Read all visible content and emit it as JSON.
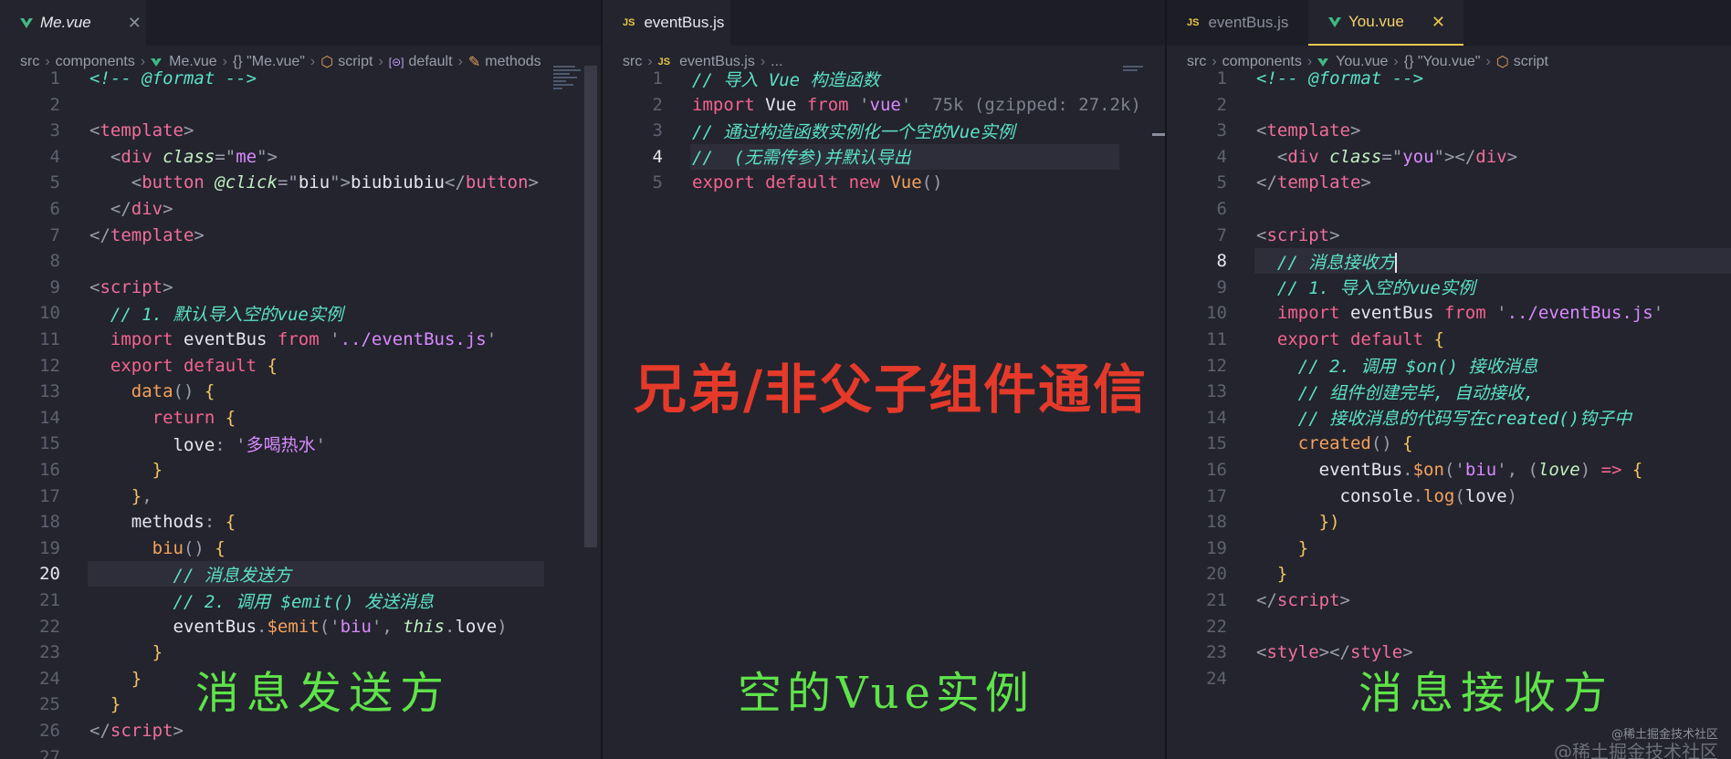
{
  "left": {
    "tab": "Me.vue",
    "crumbs": [
      "src",
      "components",
      "Me.vue",
      "{} \"Me.vue\"",
      "script",
      "default",
      "methods"
    ],
    "current_line": 20,
    "lines": [
      [
        [
          "c-com",
          "<!-- @format -->"
        ]
      ],
      [],
      [
        [
          "c-punc",
          "<"
        ],
        [
          "c-tag",
          "template"
        ],
        [
          "c-punc",
          ">"
        ]
      ],
      [
        [
          "c-plain",
          "  "
        ],
        [
          "c-punc",
          "<"
        ],
        [
          "c-tag",
          "div "
        ],
        [
          "c-attr",
          "class"
        ],
        [
          "c-punc",
          "=\""
        ],
        [
          "c-str",
          "me"
        ],
        [
          "c-punc",
          "\">"
        ]
      ],
      [
        [
          "c-plain",
          "    "
        ],
        [
          "c-punc",
          "<"
        ],
        [
          "c-tag",
          "button "
        ],
        [
          "c-attr",
          "@click"
        ],
        [
          "c-punc",
          "=\""
        ],
        [
          "c-plain",
          "biu"
        ],
        [
          "c-punc",
          "\">"
        ],
        [
          "c-plain",
          "biubiubiu"
        ],
        [
          "c-punc",
          "</"
        ],
        [
          "c-tag",
          "button"
        ],
        [
          "c-punc",
          ">"
        ]
      ],
      [
        [
          "c-plain",
          "  "
        ],
        [
          "c-punc",
          "</"
        ],
        [
          "c-tag",
          "div"
        ],
        [
          "c-punc",
          ">"
        ]
      ],
      [
        [
          "c-punc",
          "</"
        ],
        [
          "c-tag",
          "template"
        ],
        [
          "c-punc",
          ">"
        ]
      ],
      [],
      [
        [
          "c-punc",
          "<"
        ],
        [
          "c-tag",
          "script"
        ],
        [
          "c-punc",
          ">"
        ]
      ],
      [
        [
          "c-plain",
          "  "
        ],
        [
          "c-com",
          "// 1. 默认导入空的vue实例"
        ]
      ],
      [
        [
          "c-plain",
          "  "
        ],
        [
          "c-kw",
          "import "
        ],
        [
          "c-plain",
          "eventBus "
        ],
        [
          "c-kw",
          "from "
        ],
        [
          "c-punc",
          "'"
        ],
        [
          "c-str",
          "../eventBus.js"
        ],
        [
          "c-punc",
          "'"
        ]
      ],
      [
        [
          "c-plain",
          "  "
        ],
        [
          "c-kw",
          "export default "
        ],
        [
          "c-brk",
          "{"
        ]
      ],
      [
        [
          "c-plain",
          "    "
        ],
        [
          "c-fn",
          "data"
        ],
        [
          "c-punc",
          "() "
        ],
        [
          "c-brk",
          "{"
        ]
      ],
      [
        [
          "c-plain",
          "      "
        ],
        [
          "c-kw",
          "return "
        ],
        [
          "c-brk",
          "{"
        ]
      ],
      [
        [
          "c-plain",
          "        "
        ],
        [
          "c-plain",
          "love"
        ],
        [
          "c-punc",
          ": '"
        ],
        [
          "c-str",
          "多喝热水"
        ],
        [
          "c-punc",
          "'"
        ]
      ],
      [
        [
          "c-plain",
          "      "
        ],
        [
          "c-brk",
          "}"
        ]
      ],
      [
        [
          "c-plain",
          "    "
        ],
        [
          "c-brk",
          "}"
        ],
        [
          "c-punc",
          ","
        ]
      ],
      [
        [
          "c-plain",
          "    "
        ],
        [
          "c-plain",
          "methods"
        ],
        [
          "c-punc",
          ": "
        ],
        [
          "c-brk",
          "{"
        ]
      ],
      [
        [
          "c-plain",
          "      "
        ],
        [
          "c-fn",
          "biu"
        ],
        [
          "c-punc",
          "() "
        ],
        [
          "c-brk",
          "{"
        ]
      ],
      [
        [
          "c-plain",
          "        "
        ],
        [
          "c-com",
          "// 消息发送方"
        ]
      ],
      [
        [
          "c-plain",
          "        "
        ],
        [
          "c-com",
          "// 2. 调用 $emit() 发送消息"
        ]
      ],
      [
        [
          "c-plain",
          "        "
        ],
        [
          "c-plain",
          "eventBus"
        ],
        [
          "c-punc",
          "."
        ],
        [
          "c-fn",
          "$emit"
        ],
        [
          "c-punc",
          "('"
        ],
        [
          "c-str",
          "biu"
        ],
        [
          "c-punc",
          "', "
        ],
        [
          "c-attr",
          "this"
        ],
        [
          "c-punc",
          "."
        ],
        [
          "c-plain",
          "love"
        ],
        [
          "c-punc",
          ")"
        ]
      ],
      [
        [
          "c-plain",
          "      "
        ],
        [
          "c-brk",
          "}"
        ]
      ],
      [
        [
          "c-plain",
          "    "
        ],
        [
          "c-brk",
          "}"
        ]
      ],
      [
        [
          "c-plain",
          "  "
        ],
        [
          "c-brk",
          "}"
        ]
      ],
      [
        [
          "c-punc",
          "</"
        ],
        [
          "c-tag",
          "script"
        ],
        [
          "c-punc",
          ">"
        ]
      ],
      []
    ]
  },
  "mid": {
    "tab": "eventBus.js",
    "crumbs": [
      "src",
      "eventBus.js",
      "..."
    ],
    "current_line": 4,
    "lines": [
      [
        [
          "c-com",
          "// 导入 Vue 构造函数"
        ]
      ],
      [
        [
          "c-kw",
          "import "
        ],
        [
          "c-plain",
          "Vue "
        ],
        [
          "c-kw",
          "from "
        ],
        [
          "c-punc",
          "'"
        ],
        [
          "c-str",
          "vue"
        ],
        [
          "c-punc",
          "'"
        ],
        [
          "c-dim",
          "  75k (gzipped: 27.2k)"
        ]
      ],
      [
        [
          "c-com",
          "// 通过构造函数实例化一个空的Vue实例"
        ]
      ],
      [
        [
          "c-com",
          "//  (无需传参)并默认导出"
        ]
      ],
      [
        [
          "c-kw",
          "export default new "
        ],
        [
          "c-fn",
          "Vue"
        ],
        [
          "c-punc",
          "()"
        ]
      ]
    ]
  },
  "right": {
    "tabs": [
      "eventBus.js",
      "You.vue"
    ],
    "crumbs": [
      "src",
      "components",
      "You.vue",
      "{} \"You.vue\"",
      "script"
    ],
    "current_line": 8,
    "lines": [
      [
        [
          "c-com",
          "<!-- @format -->"
        ]
      ],
      [],
      [
        [
          "c-punc",
          "<"
        ],
        [
          "c-tag",
          "template"
        ],
        [
          "c-punc",
          ">"
        ]
      ],
      [
        [
          "c-plain",
          "  "
        ],
        [
          "c-punc",
          "<"
        ],
        [
          "c-tag",
          "div "
        ],
        [
          "c-attr",
          "class"
        ],
        [
          "c-punc",
          "=\""
        ],
        [
          "c-str",
          "you"
        ],
        [
          "c-punc",
          "\"></"
        ],
        [
          "c-tag",
          "div"
        ],
        [
          "c-punc",
          ">"
        ]
      ],
      [
        [
          "c-punc",
          "</"
        ],
        [
          "c-tag",
          "template"
        ],
        [
          "c-punc",
          ">"
        ]
      ],
      [],
      [
        [
          "c-punc",
          "<"
        ],
        [
          "c-tag",
          "script"
        ],
        [
          "c-punc",
          ">"
        ]
      ],
      [
        [
          "c-plain",
          "  "
        ],
        [
          "c-com",
          "// 消息接收方"
        ]
      ],
      [
        [
          "c-plain",
          "  "
        ],
        [
          "c-com",
          "// 1. 导入空的vue实例"
        ]
      ],
      [
        [
          "c-plain",
          "  "
        ],
        [
          "c-kw",
          "import "
        ],
        [
          "c-plain",
          "eventBus "
        ],
        [
          "c-kw",
          "from "
        ],
        [
          "c-punc",
          "'"
        ],
        [
          "c-str",
          "../eventBus.js"
        ],
        [
          "c-punc",
          "'"
        ]
      ],
      [
        [
          "c-plain",
          "  "
        ],
        [
          "c-kw",
          "export default "
        ],
        [
          "c-brk",
          "{"
        ]
      ],
      [
        [
          "c-plain",
          "    "
        ],
        [
          "c-com",
          "// 2. 调用 $on() 接收消息"
        ]
      ],
      [
        [
          "c-plain",
          "    "
        ],
        [
          "c-com",
          "// 组件创建完毕, 自动接收,"
        ]
      ],
      [
        [
          "c-plain",
          "    "
        ],
        [
          "c-com",
          "// 接收消息的代码写在created()钩子中"
        ]
      ],
      [
        [
          "c-plain",
          "    "
        ],
        [
          "c-fn",
          "created"
        ],
        [
          "c-punc",
          "() "
        ],
        [
          "c-brk",
          "{"
        ]
      ],
      [
        [
          "c-plain",
          "      "
        ],
        [
          "c-plain",
          "eventBus"
        ],
        [
          "c-punc",
          "."
        ],
        [
          "c-fn",
          "$on"
        ],
        [
          "c-punc",
          "('"
        ],
        [
          "c-str",
          "biu"
        ],
        [
          "c-punc",
          "', ("
        ],
        [
          "c-attr",
          "love"
        ],
        [
          "c-punc",
          ") "
        ],
        [
          "c-kw",
          "=> "
        ],
        [
          "c-brk",
          "{"
        ]
      ],
      [
        [
          "c-plain",
          "        "
        ],
        [
          "c-plain",
          "console"
        ],
        [
          "c-punc",
          "."
        ],
        [
          "c-fn",
          "log"
        ],
        [
          "c-punc",
          "("
        ],
        [
          "c-plain",
          "love"
        ],
        [
          "c-punc",
          ")"
        ]
      ],
      [
        [
          "c-plain",
          "      "
        ],
        [
          "c-brk",
          "})"
        ]
      ],
      [
        [
          "c-plain",
          "    "
        ],
        [
          "c-brk",
          "}"
        ]
      ],
      [
        [
          "c-plain",
          "  "
        ],
        [
          "c-brk",
          "}"
        ]
      ],
      [
        [
          "c-punc",
          "</"
        ],
        [
          "c-tag",
          "script"
        ],
        [
          "c-punc",
          ">"
        ]
      ],
      [],
      [
        [
          "c-punc",
          "<"
        ],
        [
          "c-tag",
          "style"
        ],
        [
          "c-punc",
          "></"
        ],
        [
          "c-tag",
          "style"
        ],
        [
          "c-punc",
          ">"
        ]
      ],
      []
    ]
  },
  "overlays": {
    "title": "兄弟/非父子组件通信",
    "left": "消息发送方",
    "mid": "空的Vue实例",
    "right": "消息接收方"
  },
  "watermark": {
    "small": "@稀土掘金技术社区",
    "large": "@稀土掘金技术社区"
  }
}
